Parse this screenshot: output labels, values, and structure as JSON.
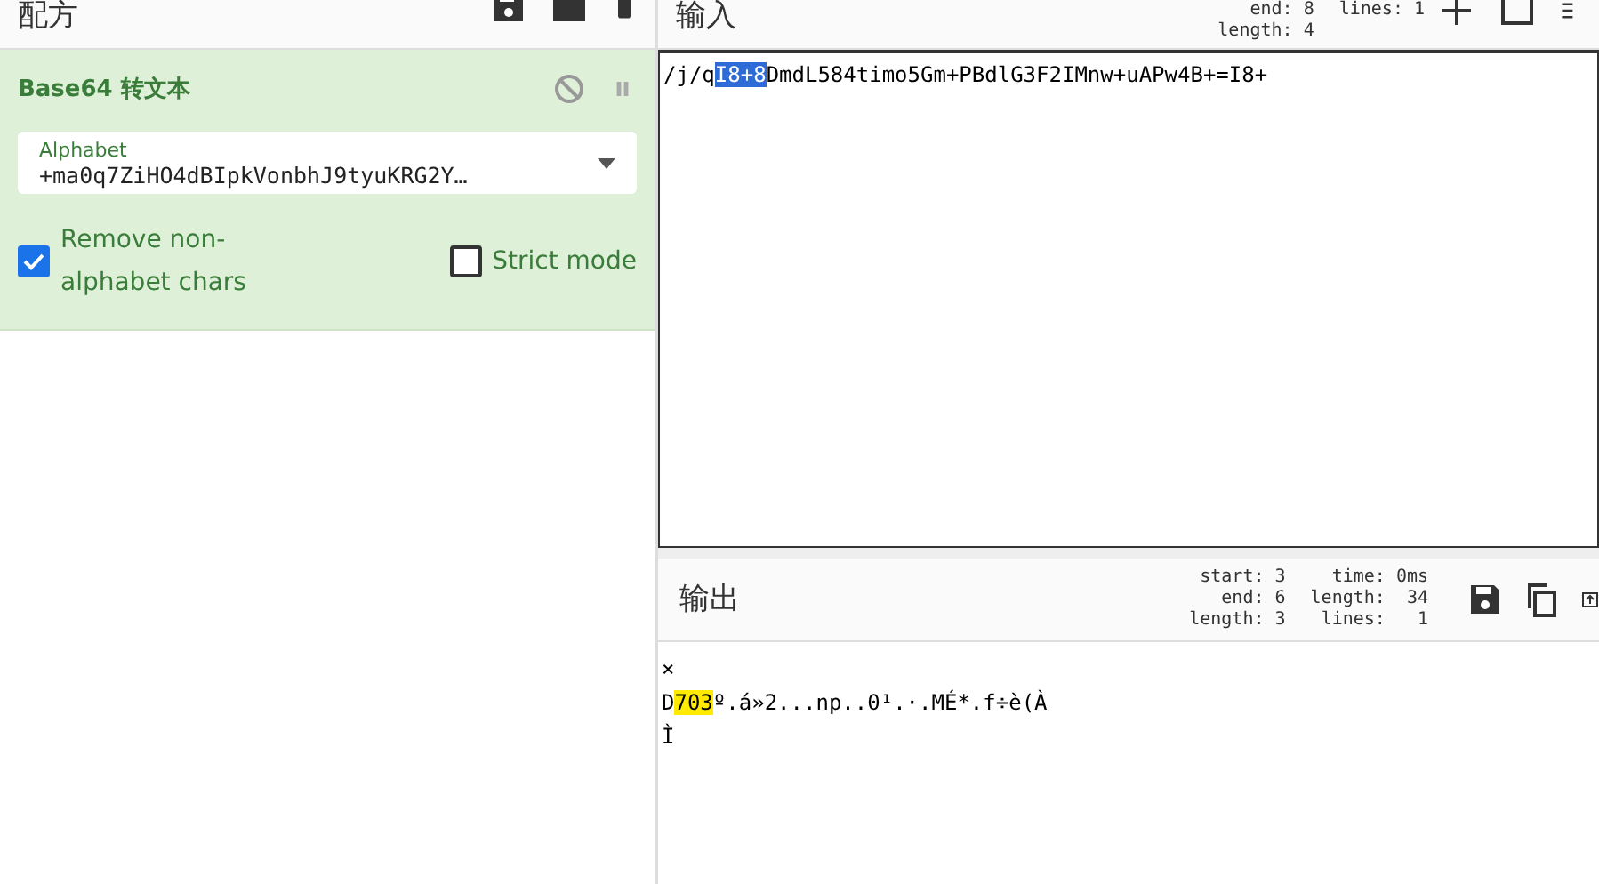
{
  "recipe": {
    "title": "配方",
    "operation": {
      "name": "Base64 转文本",
      "disabled": false,
      "paused": false,
      "alphabet": {
        "label": "Alphabet",
        "value": "+ma0q7ZiHO4dBIpkVonbhJ9tyuKRG2Y…"
      },
      "options": [
        {
          "label": "Remove non-alphabet chars",
          "checked": true
        },
        {
          "label": "Strict mode",
          "checked": false
        }
      ]
    }
  },
  "input": {
    "title": "输入",
    "stats": [
      {
        "label": "end:",
        "value": "8"
      },
      {
        "label": "length:",
        "value": "4"
      }
    ],
    "stats_2": [
      {
        "label": "lines:",
        "value": "1"
      }
    ],
    "text": [
      {
        "text": "/j/q",
        "selected": false
      },
      {
        "text": "I8+8",
        "selected": true
      },
      {
        "text": "DmdL584timo5Gm+PBdlG3F2IMnw+uAPw4B+=I8+",
        "selected": false
      }
    ]
  },
  "output": {
    "title": "输出",
    "stats": [
      {
        "label": "start:",
        "value": "3"
      },
      {
        "label": "end:",
        "value": "6"
      },
      {
        "label": "length:",
        "value": "3"
      }
    ],
    "stats_2": [
      {
        "label": "time:",
        "value": "0ms"
      },
      {
        "label": "length:",
        "value": "34"
      },
      {
        "label": "lines:",
        "value": "1"
      }
    ],
    "lines": [
      [
        {
          "text": "×",
          "highlighted": false
        }
      ],
      [
        {
          "text": "D",
          "highlighted": false
        },
        {
          "text": "703",
          "highlighted": true
        },
        {
          "text": "º.á»2...np..0¹.·.MÉ*.f÷è(À",
          "highlighted": false
        }
      ],
      [
        {
          "text": "Ì",
          "highlighted": false
        }
      ]
    ]
  }
}
